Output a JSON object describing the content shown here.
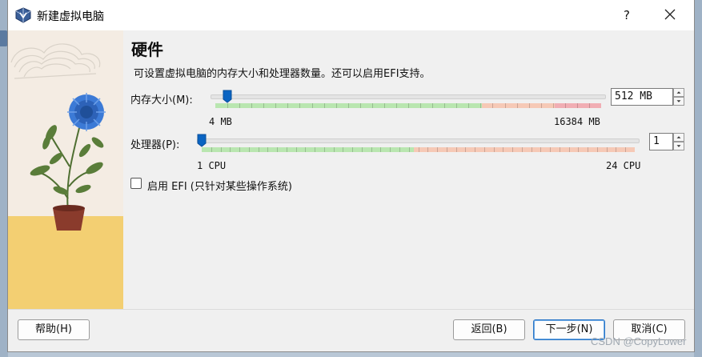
{
  "window": {
    "title": "新建虚拟电脑",
    "help_glyph": "?",
    "close_glyph": "✕",
    "app_icon": "virtualbox-icon"
  },
  "page": {
    "heading": "硬件",
    "description": "可设置虚拟电脑的内存大小和处理器数量。还可以启用EFI支持。"
  },
  "memory": {
    "label": "内存大小(M):",
    "min_label": "4 MB",
    "max_label": "16384 MB",
    "value": "512 MB",
    "min": 4,
    "max": 16384,
    "current": 512
  },
  "cpu": {
    "label": "处理器(P):",
    "min_label": "1 CPU",
    "max_label": "24 CPU",
    "value": "1",
    "min": 1,
    "max": 24,
    "current": 1
  },
  "efi": {
    "label": "启用 EFI (只针对某些操作系统)",
    "checked": false
  },
  "buttons": {
    "help": "帮助(H)",
    "back": "返回(B)",
    "next": "下一步(N)",
    "cancel": "取消(C)"
  },
  "colors": {
    "accent": "#0a64c2",
    "band_green": "#b9e6b0",
    "band_orange": "#f6c9b6",
    "band_red": "#f1aeb4",
    "sand": "#f3cf72"
  },
  "watermark": "CSDN @CopyLower"
}
